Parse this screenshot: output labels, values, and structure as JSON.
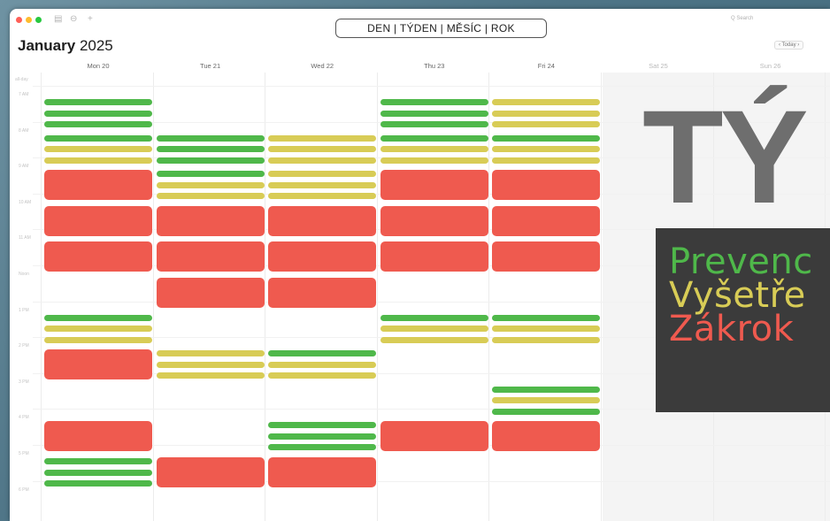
{
  "view_switcher": {
    "label": "DEN | TÝDEN | MĚSÍC | ROK"
  },
  "header": {
    "month": "January",
    "year": "2025",
    "search_placeholder": "Q Search",
    "today_label": "‹ Today ›"
  },
  "days": [
    {
      "label": "Mon 20"
    },
    {
      "label": "Tue 21"
    },
    {
      "label": "Wed 22"
    },
    {
      "label": "Thu 23"
    },
    {
      "label": "Fri 24"
    },
    {
      "label": "Sat 25"
    },
    {
      "label": "Sun 26"
    }
  ],
  "allday_label": "all-day",
  "time_labels": [
    "7 AM",
    "8 AM",
    "9 AM",
    "10 AM",
    "11 AM",
    "Noon",
    "1 PM",
    "2 PM",
    "3 PM",
    "4 PM",
    "5 PM",
    "6 PM"
  ],
  "overlay": {
    "big_text": "TÝ",
    "legend": [
      {
        "text": "Prevenc",
        "color": "#4fb84a"
      },
      {
        "text": "Vyšetře",
        "color": "#d8cc56"
      },
      {
        "text": "Zákrok",
        "color": "#ef5a4f"
      }
    ]
  },
  "colors": {
    "prevence": "#4fb84a",
    "vysetreni": "#d8cc56",
    "zakrok": "#ef5a4f"
  },
  "events": [
    {
      "day": 0,
      "slot": 0,
      "type": "stack",
      "colors": [
        "g",
        "g",
        "g"
      ]
    },
    {
      "day": 0,
      "slot": 1,
      "type": "stack",
      "colors": [
        "g",
        "y",
        "y"
      ]
    },
    {
      "day": 0,
      "slot": 2,
      "type": "block"
    },
    {
      "day": 0,
      "slot": 3,
      "type": "block"
    },
    {
      "day": 0,
      "slot": 4,
      "type": "block"
    },
    {
      "day": 0,
      "slot": 6,
      "type": "stack",
      "colors": [
        "g",
        "y",
        "y"
      ]
    },
    {
      "day": 0,
      "slot": 7,
      "type": "block"
    },
    {
      "day": 0,
      "slot": 9,
      "type": "block"
    },
    {
      "day": 0,
      "slot": 10,
      "type": "stack",
      "colors": [
        "g",
        "g",
        "g"
      ]
    },
    {
      "day": 1,
      "slot": 1,
      "type": "stack",
      "colors": [
        "g",
        "g",
        "g"
      ]
    },
    {
      "day": 1,
      "slot": 2,
      "type": "stack",
      "colors": [
        "g",
        "y",
        "y"
      ]
    },
    {
      "day": 1,
      "slot": 3,
      "type": "block"
    },
    {
      "day": 1,
      "slot": 4,
      "type": "block"
    },
    {
      "day": 1,
      "slot": 5,
      "type": "block"
    },
    {
      "day": 1,
      "slot": 7,
      "type": "stack",
      "colors": [
        "y",
        "y",
        "y"
      ]
    },
    {
      "day": 1,
      "slot": 10,
      "type": "block"
    },
    {
      "day": 2,
      "slot": 1,
      "type": "stack",
      "colors": [
        "y",
        "y",
        "y"
      ]
    },
    {
      "day": 2,
      "slot": 2,
      "type": "stack",
      "colors": [
        "y",
        "y",
        "y"
      ]
    },
    {
      "day": 2,
      "slot": 3,
      "type": "block"
    },
    {
      "day": 2,
      "slot": 4,
      "type": "block"
    },
    {
      "day": 2,
      "slot": 5,
      "type": "block"
    },
    {
      "day": 2,
      "slot": 7,
      "type": "stack",
      "colors": [
        "g",
        "y",
        "y"
      ]
    },
    {
      "day": 2,
      "slot": 9,
      "type": "stack",
      "colors": [
        "g",
        "g",
        "g"
      ]
    },
    {
      "day": 2,
      "slot": 10,
      "type": "block"
    },
    {
      "day": 3,
      "slot": 0,
      "type": "stack",
      "colors": [
        "g",
        "g",
        "g"
      ]
    },
    {
      "day": 3,
      "slot": 1,
      "type": "stack",
      "colors": [
        "g",
        "y",
        "y"
      ]
    },
    {
      "day": 3,
      "slot": 2,
      "type": "block"
    },
    {
      "day": 3,
      "slot": 3,
      "type": "block"
    },
    {
      "day": 3,
      "slot": 4,
      "type": "block"
    },
    {
      "day": 3,
      "slot": 6,
      "type": "stack",
      "colors": [
        "g",
        "y",
        "y"
      ]
    },
    {
      "day": 3,
      "slot": 9,
      "type": "block"
    },
    {
      "day": 4,
      "slot": 0,
      "type": "stack",
      "colors": [
        "y",
        "y",
        "y"
      ]
    },
    {
      "day": 4,
      "slot": 1,
      "type": "stack",
      "colors": [
        "g",
        "y",
        "y"
      ]
    },
    {
      "day": 4,
      "slot": 2,
      "type": "block"
    },
    {
      "day": 4,
      "slot": 3,
      "type": "block"
    },
    {
      "day": 4,
      "slot": 4,
      "type": "block"
    },
    {
      "day": 4,
      "slot": 6,
      "type": "stack",
      "colors": [
        "g",
        "y",
        "y"
      ]
    },
    {
      "day": 4,
      "slot": 8,
      "type": "stack",
      "colors": [
        "g",
        "y",
        "g"
      ]
    },
    {
      "day": 4,
      "slot": 9,
      "type": "block"
    }
  ]
}
